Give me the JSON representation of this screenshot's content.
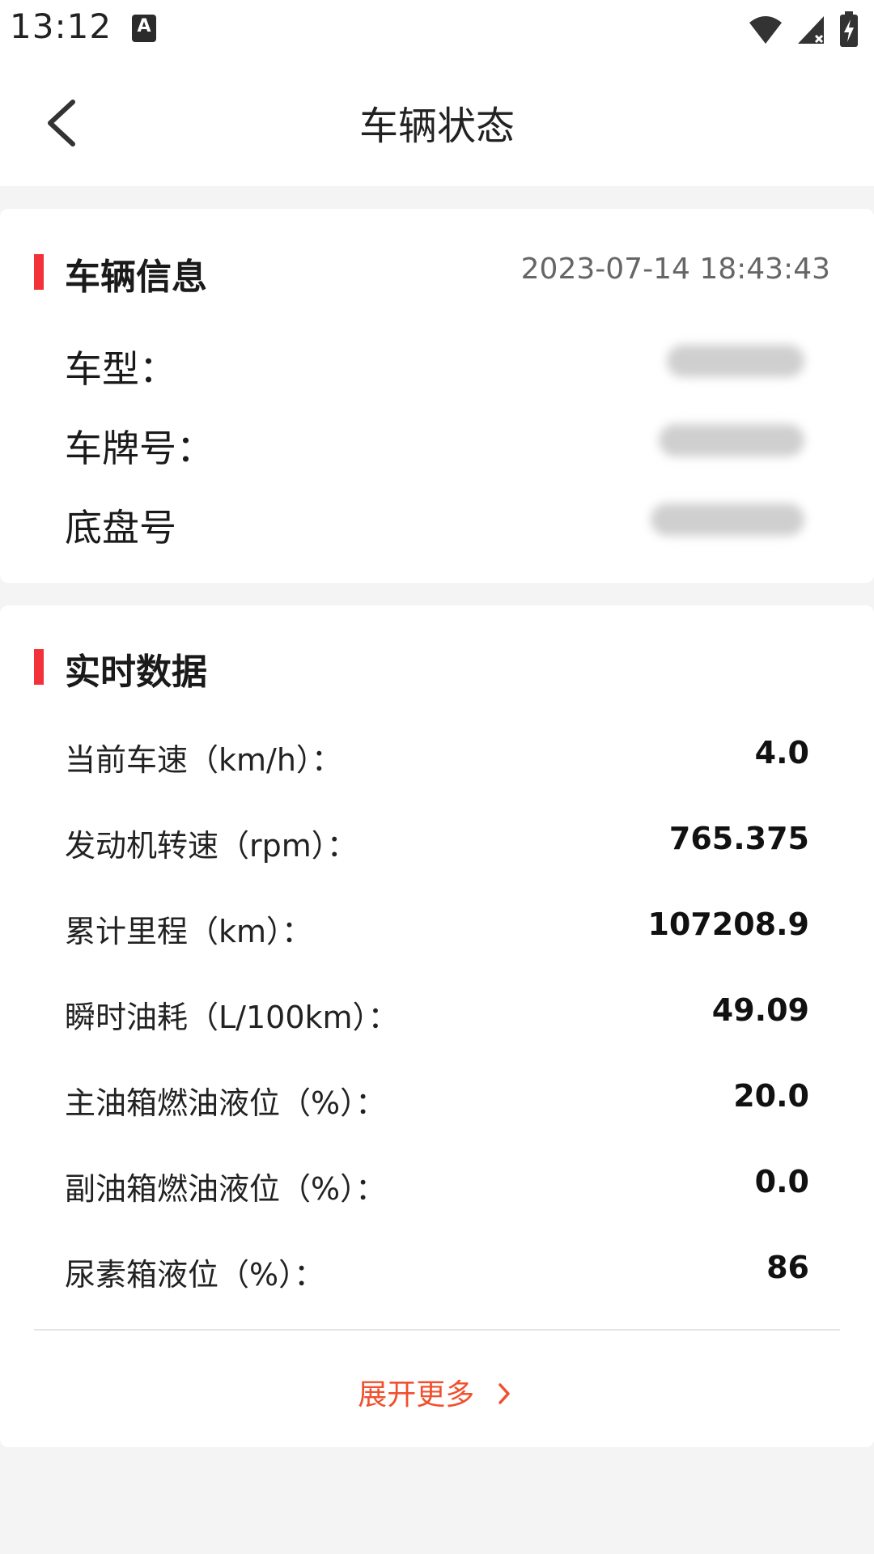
{
  "status_bar": {
    "time": "13:12",
    "notification_icon_letter": "A"
  },
  "header": {
    "title": "车辆状态"
  },
  "vehicle_info": {
    "section_title": "车辆信息",
    "timestamp": "2023-07-14 18:43:43",
    "fields": [
      {
        "label": "车型："
      },
      {
        "label": "车牌号："
      },
      {
        "label": "底盘号"
      }
    ]
  },
  "realtime": {
    "section_title": "实时数据",
    "rows": [
      {
        "label": "当前车速（km/h）：",
        "value": "4.0"
      },
      {
        "label": "发动机转速（rpm）：",
        "value": "765.375"
      },
      {
        "label": "累计里程（km）：",
        "value": "107208.9"
      },
      {
        "label": "瞬时油耗（L/100km）：",
        "value": "49.09"
      },
      {
        "label": "主油箱燃油液位（%）：",
        "value": "20.0"
      },
      {
        "label": "副油箱燃油液位（%）：",
        "value": "0.0"
      },
      {
        "label": "尿素箱液位（%）：",
        "value": "86"
      }
    ],
    "expand_label": "展开更多"
  },
  "colors": {
    "accent_red": "#f3313a",
    "link_orange": "#f0502e",
    "background": "#f4f4f4"
  }
}
